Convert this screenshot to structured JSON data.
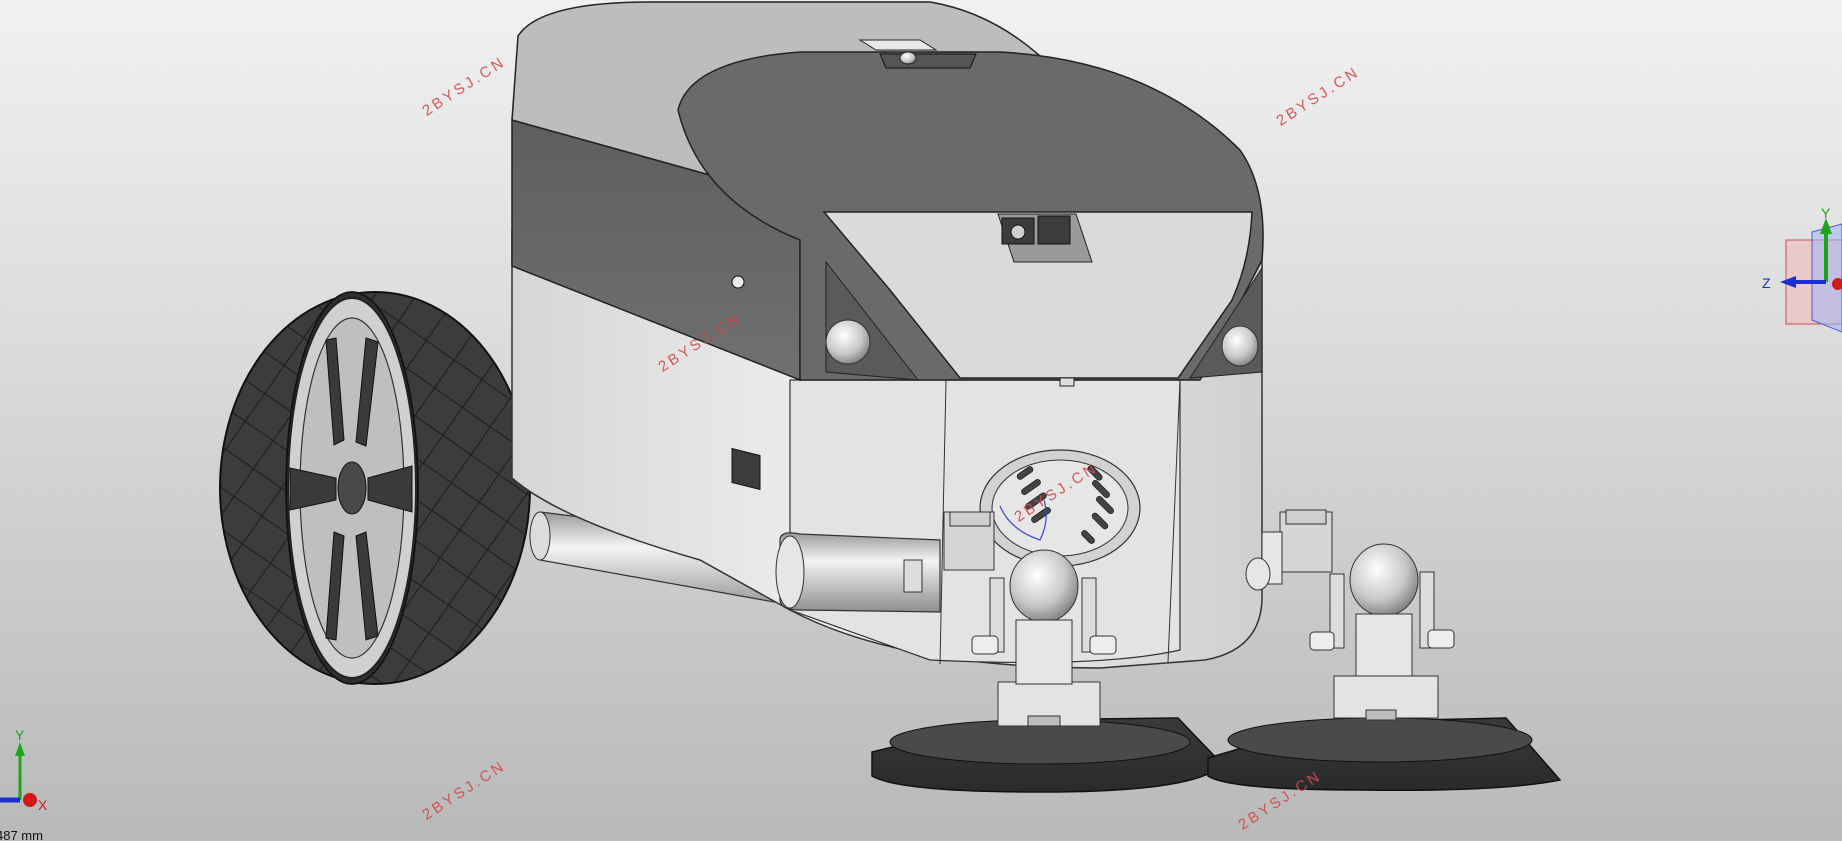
{
  "viewport": {
    "model": "sweeper-robot-assembly",
    "background_top": "#f1f1f1",
    "background_bottom": "#b9b9b9"
  },
  "watermarks": {
    "text": "2BYSJ.CN",
    "color": "#d14a4a",
    "count": 7
  },
  "view_triad": {
    "labels": {
      "y": "Y",
      "z": "Z"
    },
    "colors": {
      "y": "#1aa51a",
      "z": "#1a2fcf",
      "x": "#d01a1a"
    }
  },
  "origin_triad": {
    "labels": {
      "y": "Y",
      "x": "X"
    }
  },
  "scale_readout": {
    "text": "487 mm"
  }
}
